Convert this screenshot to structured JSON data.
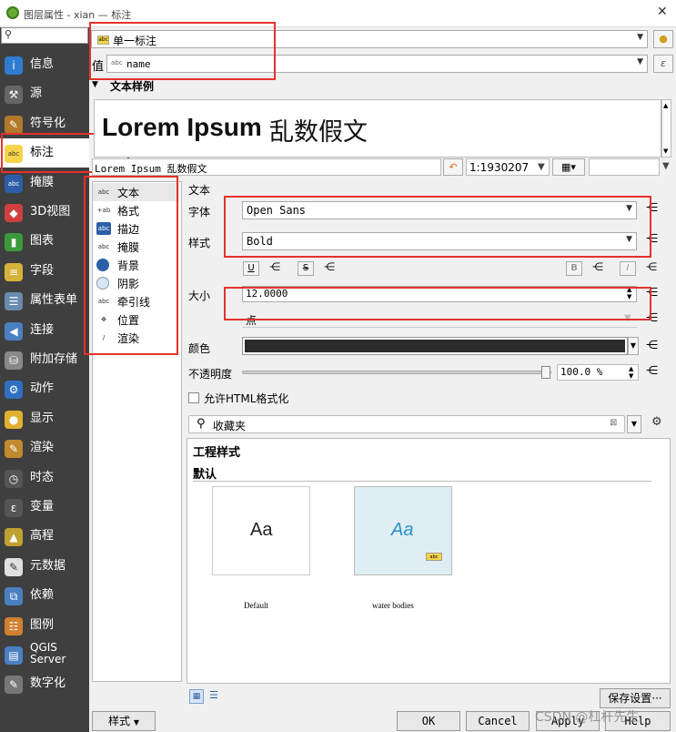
{
  "window": {
    "title": "图层属性 - xian — 标注",
    "close": "✕"
  },
  "sidebar": {
    "search_icon": "search-icon",
    "items": [
      {
        "label": "信息",
        "icon": "info-icon",
        "color": "#2f7bd0",
        "glyph": "i"
      },
      {
        "label": "源",
        "icon": "wrench-icon",
        "color": "#666",
        "glyph": "⚒"
      },
      {
        "label": "符号化",
        "icon": "paintbrush-icon",
        "color": "#b07a2a",
        "glyph": "✎"
      },
      {
        "label": "标注",
        "icon": "label-icon",
        "color": "#f5d44a",
        "glyph": "abc"
      },
      {
        "label": "掩膜",
        "icon": "mask-icon",
        "color": "#2d5fa8",
        "glyph": "abc"
      },
      {
        "label": "3D视图",
        "icon": "cube-icon",
        "color": "#d04040",
        "glyph": "◆"
      },
      {
        "label": "图表",
        "icon": "chart-icon",
        "color": "#3a9a3a",
        "glyph": "▮"
      },
      {
        "label": "字段",
        "icon": "fields-icon",
        "color": "#d7b23a",
        "glyph": "≡"
      },
      {
        "label": "属性表单",
        "icon": "form-icon",
        "color": "#6a8ab0",
        "glyph": "☰"
      },
      {
        "label": "连接",
        "icon": "join-icon",
        "color": "#4a7fc0",
        "glyph": "◀"
      },
      {
        "label": "附加存储",
        "icon": "database-icon",
        "color": "#888",
        "glyph": "⛁"
      },
      {
        "label": "动作",
        "icon": "action-icon",
        "color": "#2f6fc0",
        "glyph": "⚙"
      },
      {
        "label": "显示",
        "icon": "speech-icon",
        "color": "#e0b030",
        "glyph": "●"
      },
      {
        "label": "渲染",
        "icon": "brush-icon",
        "color": "#c08a30",
        "glyph": "✎"
      },
      {
        "label": "时态",
        "icon": "clock-icon",
        "color": "#555",
        "glyph": "◷"
      },
      {
        "label": "变量",
        "icon": "variable-icon",
        "color": "#555",
        "glyph": "ε"
      },
      {
        "label": "高程",
        "icon": "elevation-icon",
        "color": "#c0a030",
        "glyph": "▲"
      },
      {
        "label": "元数据",
        "icon": "metadata-icon",
        "color": "#e0e0e0",
        "glyph": "✎"
      },
      {
        "label": "依赖",
        "icon": "dependency-icon",
        "color": "#4a7fc0",
        "glyph": "⧉"
      },
      {
        "label": "图例",
        "icon": "legend-icon",
        "color": "#d08030",
        "glyph": "☷"
      },
      {
        "label": "QGIS Server",
        "icon": "server-icon",
        "color": "#4a7fc0",
        "glyph": "▤"
      },
      {
        "label": "数字化",
        "icon": "digitize-icon",
        "color": "#777",
        "glyph": "✎"
      }
    ]
  },
  "top": {
    "mode": "单一标注",
    "value_label": "值",
    "value_field": "name",
    "value_type": "abc",
    "expr": "ε"
  },
  "preview": {
    "section": "文本样例",
    "sample_bold": "Lorem Ipsum",
    "sample_cjk": "乱数假文",
    "sample_input": "Lorem Ipsum 乱数假文",
    "scale": "1:1930207"
  },
  "subtabs": [
    {
      "label": "文本",
      "icon": "text-icon",
      "glyph": "abc"
    },
    {
      "label": "格式",
      "icon": "formatting-icon",
      "glyph": "+ab"
    },
    {
      "label": "描边",
      "icon": "buffer-icon",
      "glyph": "abc"
    },
    {
      "label": "掩膜",
      "icon": "mask-icon",
      "glyph": "abc"
    },
    {
      "label": "背景",
      "icon": "background-icon",
      "glyph": ""
    },
    {
      "label": "阴影",
      "icon": "shadow-icon",
      "glyph": ""
    },
    {
      "label": "牵引线",
      "icon": "callout-icon",
      "glyph": "abc"
    },
    {
      "label": "位置",
      "icon": "placement-icon",
      "glyph": "✥"
    },
    {
      "label": "渲染",
      "icon": "rendering-icon",
      "glyph": "/"
    }
  ],
  "text": {
    "heading": "文本",
    "font_label": "字体",
    "font": "Open Sans",
    "style_label": "样式",
    "style": "Bold",
    "underline": "U",
    "strike": "S",
    "bold": "B",
    "italic": "I",
    "size_label": "大小",
    "size": "12.0000",
    "unit": "点",
    "color_label": "颜色",
    "color": "#2b2b2b",
    "opacity_label": "不透明度",
    "opacity": "100.0 %",
    "opacity_value": 1.0,
    "html_label": "允许HTML格式化"
  },
  "styles": {
    "search": "收藏夹",
    "group1": "工程样式",
    "group2": "默认",
    "tiles": [
      {
        "name": "Default",
        "sample": "Aa"
      },
      {
        "name": "water bodies",
        "sample": "Aa"
      }
    ],
    "save": "保存设置···"
  },
  "footer": {
    "style": "样式",
    "ok": "OK",
    "cancel": "Cancel",
    "apply": "Apply",
    "help": "Help"
  },
  "watermark": "CSDN @杠杆先生"
}
